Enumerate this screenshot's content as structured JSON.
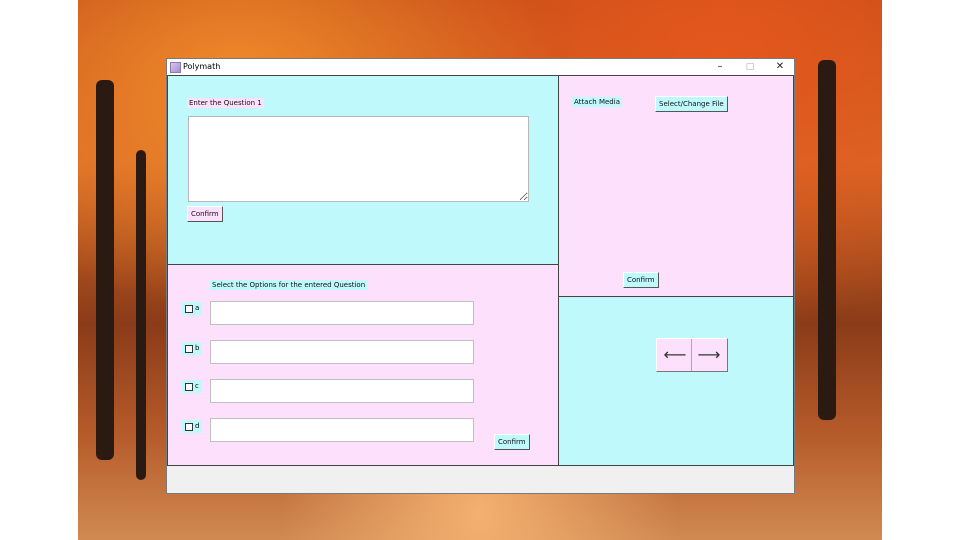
{
  "window": {
    "title": "Polymath",
    "controls": {
      "minimize": "–",
      "maximize": "□",
      "close": "✕"
    }
  },
  "question_panel": {
    "label": "Enter the Question 1",
    "question_value": "",
    "confirm_label": "Confirm"
  },
  "media_panel": {
    "label": "Attach Media",
    "select_file_label": "Select/Change File",
    "confirm_label": "Confirm"
  },
  "options_panel": {
    "label": "Select the Options for the entered Question",
    "options": [
      {
        "letter": "a",
        "checked": false,
        "value": ""
      },
      {
        "letter": "b",
        "checked": false,
        "value": ""
      },
      {
        "letter": "c",
        "checked": false,
        "value": ""
      },
      {
        "letter": "d",
        "checked": false,
        "value": ""
      }
    ],
    "confirm_label": "Confirm"
  },
  "navigation": {
    "prev_symbol": "⟵",
    "next_symbol": "⟶"
  },
  "colors": {
    "cyan": "#bff9fb",
    "pink": "#fde1fc"
  }
}
